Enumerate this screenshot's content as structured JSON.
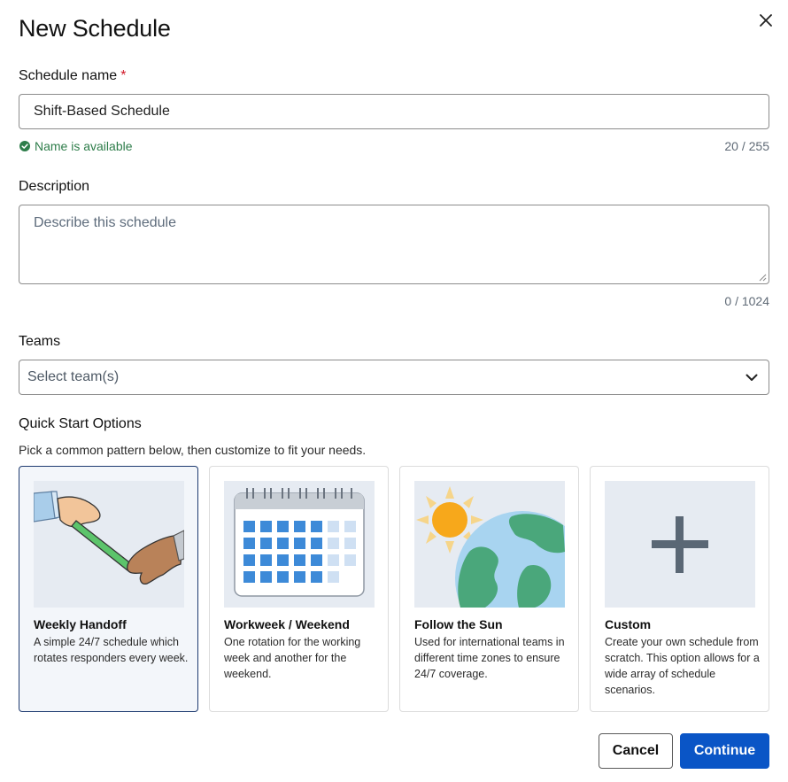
{
  "dialog": {
    "title": "New Schedule"
  },
  "name_field": {
    "label": "Schedule name",
    "required_marker": "*",
    "value": "Shift-Based Schedule",
    "status": "Name is available",
    "counter": "20 / 255"
  },
  "description_field": {
    "label": "Description",
    "placeholder": "Describe this schedule",
    "value": "",
    "counter": "0 / 1024"
  },
  "teams_field": {
    "label": "Teams",
    "placeholder": "Select team(s)"
  },
  "quick_start": {
    "title": "Quick Start Options",
    "subtitle": "Pick a common pattern below, then customize to fit your needs.",
    "options": [
      {
        "title": "Weekly Handoff",
        "description": "A simple 24/7 schedule which rotates responders every week.",
        "icon": "baton-handoff-illustration",
        "selected": true
      },
      {
        "title": "Workweek / Weekend",
        "description": "One rotation for the working week and another for the weekend.",
        "icon": "calendar-illustration",
        "selected": false
      },
      {
        "title": "Follow the Sun",
        "description": "Used for international teams in different time zones to ensure 24/7 coverage.",
        "icon": "sun-globe-illustration",
        "selected": false
      },
      {
        "title": "Custom",
        "description": "Create your own schedule from scratch. This option allows for a wide array of schedule scenarios.",
        "icon": "plus-icon",
        "selected": false
      }
    ]
  },
  "actions": {
    "cancel_label": "Cancel",
    "continue_label": "Continue"
  },
  "colors": {
    "primary": "#0a55c6",
    "success": "#2e7d4a",
    "required": "#d11a2a",
    "selected_border": "#1f3b70"
  }
}
